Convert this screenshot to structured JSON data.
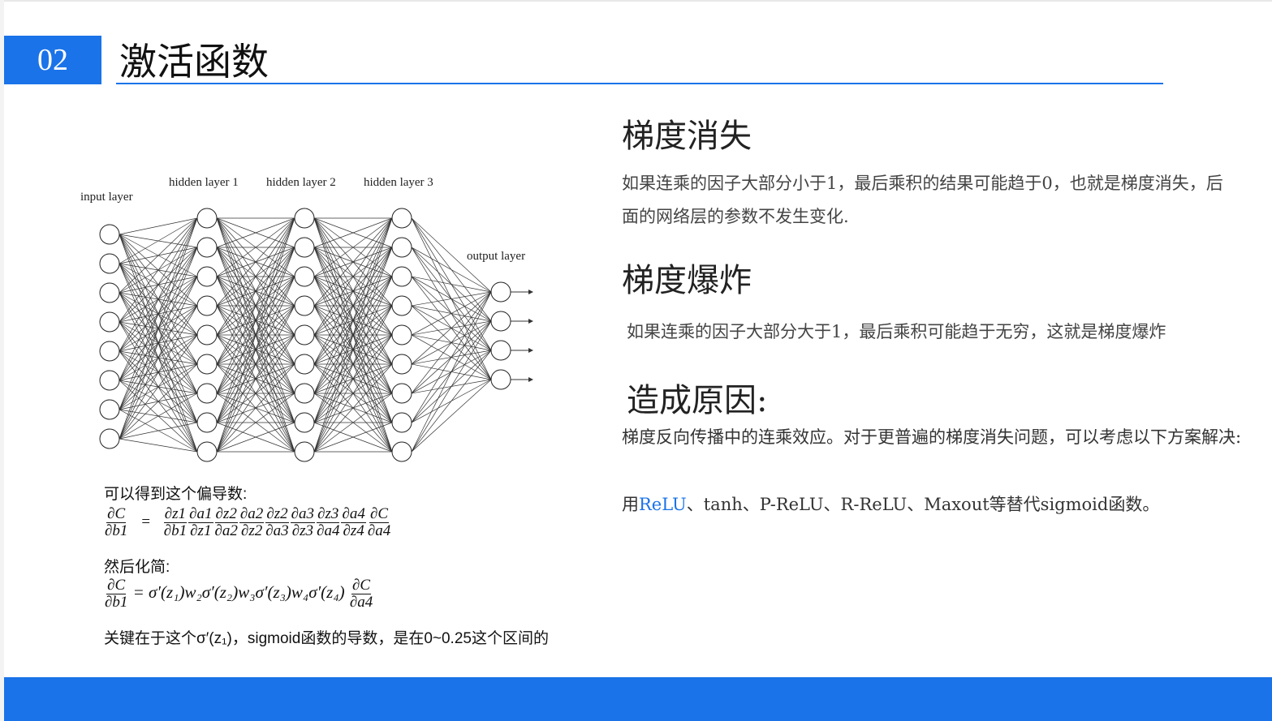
{
  "section": {
    "number": "02",
    "title": "激活函数"
  },
  "network": {
    "labels": {
      "input": "input layer",
      "hidden1": "hidden layer 1",
      "hidden2": "hidden layer 2",
      "hidden3": "hidden layer 3",
      "output": "output layer"
    },
    "layer_sizes": [
      8,
      9,
      9,
      9,
      4
    ]
  },
  "formulas": {
    "derivative_label": "可以得到这个偏导数:",
    "chain_lhs_num": "∂C",
    "chain_lhs_den": "∂b1",
    "chain_terms": [
      {
        "n": "∂z1",
        "d": "∂b1"
      },
      {
        "n": "∂a1",
        "d": "∂z1"
      },
      {
        "n": "∂z2",
        "d": "∂a2"
      },
      {
        "n": "∂a2",
        "d": "∂z2"
      },
      {
        "n": "∂z2",
        "d": "∂a3"
      },
      {
        "n": "∂a3",
        "d": "∂z3"
      },
      {
        "n": "∂z3",
        "d": "∂a4"
      },
      {
        "n": "∂a4",
        "d": "∂z4"
      },
      {
        "n": "∂C",
        "d": "∂a4"
      }
    ],
    "simplify_label": "然后化简:",
    "simplified_rhs": "= σ′(z₁)w₂σ′(z₂)w₃σ′(z₃)w₄σ′(z₄)",
    "key_note": "关键在于这个σ′(z₁)，sigmoid函数的导数，是在0~0.25这个区间的"
  },
  "right": {
    "vanish_title": "梯度消失",
    "vanish_text": "如果连乘的因子大部分小于1，最后乘积的结果可能趋于0，也就是梯度消失，后面的网络层的参数不发生变化.",
    "explode_title": "梯度爆炸",
    "explode_text": "如果连乘的因子大部分大于1，最后乘积可能趋于无穷，这就是梯度爆炸",
    "cause_title": "造成原因:",
    "cause_text": "梯度反向传播中的连乘效应。对于更普遍的梯度消失问题，可以考虑以下方案解决:",
    "solution_prefix": "用",
    "solution_link": "ReLU",
    "solution_rest": "、tanh、P-ReLU、R-ReLU、Maxout等替代sigmoid函数。"
  },
  "colors": {
    "accent": "#1a73e8"
  }
}
